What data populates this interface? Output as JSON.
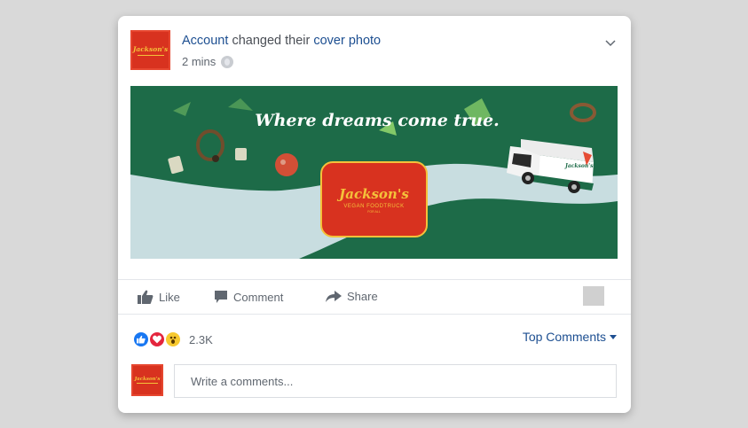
{
  "post": {
    "author": "Account",
    "action": "changed their",
    "object": "cover photo",
    "time": "2 mins",
    "avatar_brand": "Jackson's",
    "privacy_icon": "globe-icon"
  },
  "cover": {
    "tagline": "Where dreams come true.",
    "logo_brand": "Jackson's",
    "logo_sub": "VEGAN FOODTRUCK",
    "logo_tiny": "FOR ALL",
    "truck_brand": "Jackson's",
    "colors": {
      "background": "#1d6b48",
      "road": "#c8dde0",
      "logo": "#d8321f",
      "accent": "#f4c13a"
    }
  },
  "actions": {
    "like": "Like",
    "comment": "Comment",
    "share": "Share"
  },
  "reactions": {
    "icons": [
      "like-reaction-icon",
      "love-reaction-icon",
      "wow-reaction-icon"
    ],
    "count": "2.3K"
  },
  "comments": {
    "sort_label": "Top Comments",
    "input_placeholder": "Write a comments...",
    "avatar_brand": "Jackson's"
  }
}
